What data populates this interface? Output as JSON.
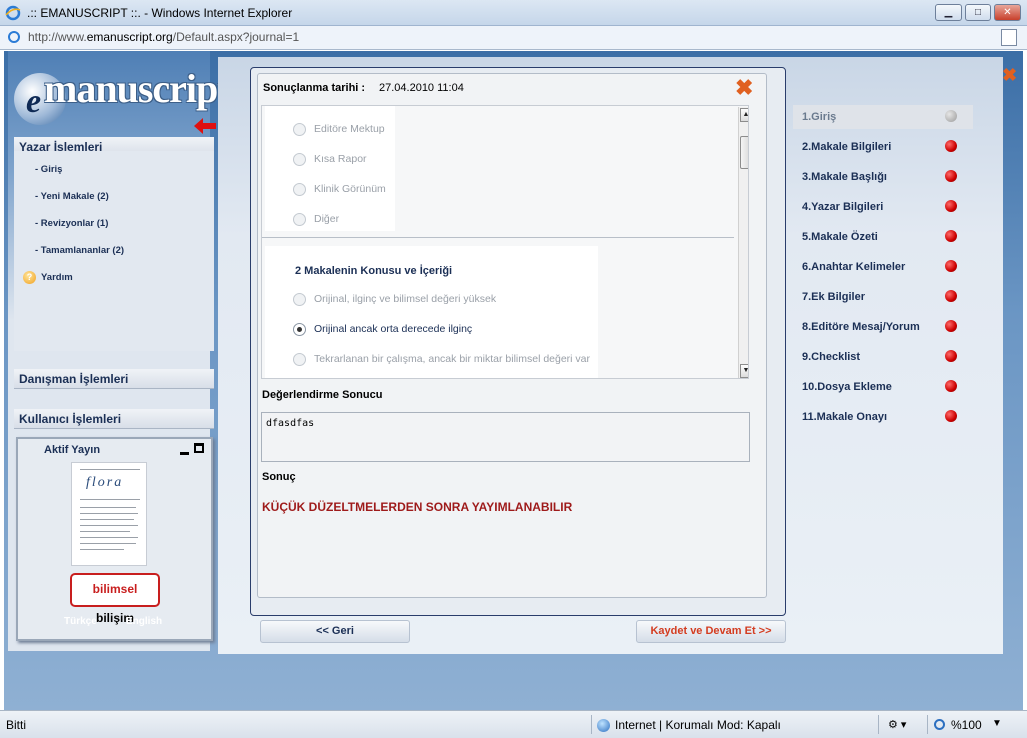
{
  "window": {
    "title": ".:: EMANUSCRIPT ::. - Windows Internet Explorer",
    "url_prefix": "http://www.",
    "url_domain": "emanuscript.org",
    "url_path": "/Default.aspx?journal=1",
    "min_label": "▁",
    "max_label": "□",
    "close_label": "✕"
  },
  "logo": {
    "e": "e",
    "word": "manuscript"
  },
  "sidebar": {
    "yazar_title": "Yazar İşlemleri",
    "yazar_items": [
      {
        "label": "- Giriş"
      },
      {
        "label": "- Yeni Makale (2)"
      },
      {
        "label": "- Revizyonlar (1)"
      },
      {
        "label": "- Tamamlananlar (2)"
      }
    ],
    "help_label": "Yardım",
    "danisman_title": "Danışman İşlemleri",
    "kullanici_title": "Kullanıcı İşlemleri",
    "aktif_title": "Aktif Yayın",
    "journal_name": "flora",
    "brand_a": "bilimsel",
    "brand_b": "bilişim",
    "lang_tr": "Türkçe",
    "lang_en": "English"
  },
  "form": {
    "date_label": "Sonuçlanma tarihi :",
    "date_value": "27.04.2010 11:04",
    "close_glyph": "✖",
    "group1_options": [
      {
        "label": "Editöre Mektup",
        "checked": false
      },
      {
        "label": "Kısa Rapor",
        "checked": false
      },
      {
        "label": "Klinik Görünüm",
        "checked": false
      },
      {
        "label": "Diğer",
        "checked": false
      }
    ],
    "group2_title": "2 Makalenin Konusu ve İçeriği",
    "group2_options": [
      {
        "label": "Orijinal, ilginç ve bilimsel değeri yüksek",
        "checked": false
      },
      {
        "label": "Orijinal ancak orta derecede ilginç",
        "checked": true
      },
      {
        "label": "Tekrarlanan bir çalışma, ancak bir miktar bilimsel değeri var",
        "checked": false
      }
    ],
    "eval_label": "Değerlendirme Sonucu",
    "eval_value": "dfasdfas",
    "result_label": "Sonuç",
    "result_value": "KÜÇÜK DÜZELTMELERDEN SONRA YAYIMLANABILIR",
    "back_button": "<< Geri",
    "save_button": "Kaydet ve Devam Et >>"
  },
  "steps": [
    {
      "label": "1.Giriş",
      "active": true
    },
    {
      "label": "2.Makale Bilgileri",
      "active": false
    },
    {
      "label": "3.Makale Başlığı",
      "active": false
    },
    {
      "label": "4.Yazar Bilgileri",
      "active": false
    },
    {
      "label": "5.Makale Özeti",
      "active": false
    },
    {
      "label": "6.Anahtar Kelimeler",
      "active": false
    },
    {
      "label": "7.Ek Bilgiler",
      "active": false
    },
    {
      "label": "8.Editöre Mesaj/Yorum",
      "active": false
    },
    {
      "label": "9.Checklist",
      "active": false
    },
    {
      "label": "10.Dosya Ekleme",
      "active": false
    },
    {
      "label": "11.Makale Onayı",
      "active": false
    }
  ],
  "page_close_glyph": "✖",
  "status": {
    "left": "Bitti",
    "zone": "Internet | Korumalı Mod: Kapalı",
    "zoom": "%100"
  }
}
